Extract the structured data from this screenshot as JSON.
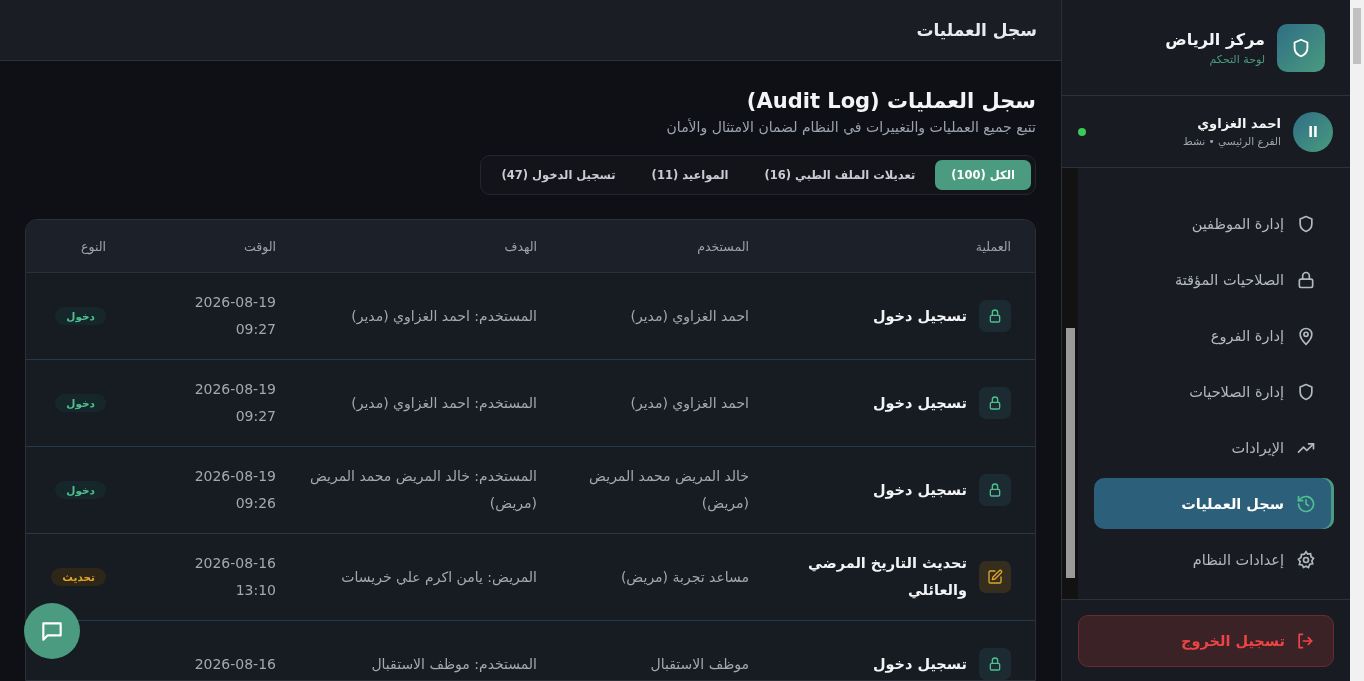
{
  "header": {
    "title": "سجل العمليات"
  },
  "page": {
    "title": "سجل العمليات (Audit Log)",
    "subtitle": "تتبع جميع العمليات والتغييرات في النظام لضمان الامتثال والأمان"
  },
  "tabs": [
    {
      "label": "الكل (100)",
      "selected": true
    },
    {
      "label": "تعديلات الملف الطبي (16)",
      "selected": false
    },
    {
      "label": "المواعيد (11)",
      "selected": false
    },
    {
      "label": "تسجيل الدخول (47)",
      "selected": false
    }
  ],
  "table": {
    "columns": [
      "العملية",
      "المستخدم",
      "الهدف",
      "الوقت",
      "النوع"
    ],
    "rows": [
      {
        "kind": "login",
        "operation": "تسجيل دخول",
        "user": "احمد الغزاوي (مدير)",
        "target": "المستخدم: احمد الغزاوي (مدير)",
        "date": "2026-08-19",
        "time": "09:27",
        "type": "دخول"
      },
      {
        "kind": "login",
        "operation": "تسجيل دخول",
        "user": "احمد الغزاوي (مدير)",
        "target": "المستخدم: احمد الغزاوي (مدير)",
        "date": "2026-08-19",
        "time": "09:27",
        "type": "دخول"
      },
      {
        "kind": "login",
        "operation": "تسجيل دخول",
        "user": "خالد المريض محمد المريض (مريض)",
        "target": "المستخدم: خالد المريض محمد المريض (مريض)",
        "date": "2026-08-19",
        "time": "09:26",
        "type": "دخول"
      },
      {
        "kind": "update",
        "operation": "تحديث التاريخ المرضي والعائلي",
        "user": "مساعد تجربة (مريض)",
        "target": "المريض: يامن اكرم علي خريسات",
        "date": "2026-08-16",
        "time": "13:10",
        "type": "تحديث"
      },
      {
        "kind": "login",
        "operation": "تسجيل دخول",
        "user": "موظف الاستقبال",
        "target": "المستخدم: موظف الاستقبال",
        "date": "2026-08-16"
      }
    ]
  },
  "sidebar": {
    "brand": {
      "title": "مركز الرياض",
      "subtitle": "لوحة التحكم"
    },
    "user": {
      "initials": "اا",
      "name": "احمد الغزاوي",
      "meta": "الفرع الرئيسي • نشط",
      "online": true
    },
    "items": [
      {
        "kind": "shield",
        "label": "إدارة الموظفين",
        "selected": false
      },
      {
        "kind": "lock",
        "label": "الصلاحيات المؤقتة",
        "selected": false
      },
      {
        "kind": "pin",
        "label": "إدارة الفروع",
        "selected": false
      },
      {
        "kind": "shield",
        "label": "إدارة الصلاحيات",
        "selected": false
      },
      {
        "kind": "trend",
        "label": "الإيرادات",
        "selected": false
      },
      {
        "kind": "history",
        "label": "سجل العمليات",
        "selected": true
      },
      {
        "kind": "gear",
        "label": "إعدادات النظام",
        "selected": false
      }
    ],
    "logout": "تسجيل الخروج"
  }
}
